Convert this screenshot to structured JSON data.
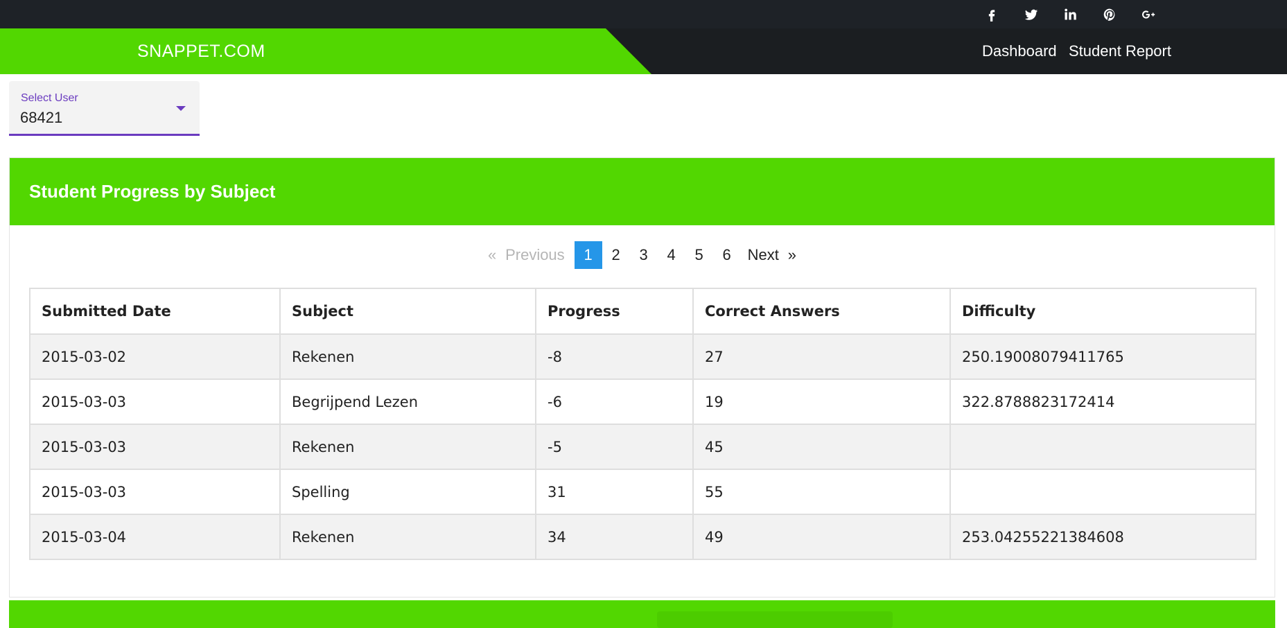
{
  "social": [
    {
      "name": "facebook-icon"
    },
    {
      "name": "twitter-icon"
    },
    {
      "name": "linkedin-icon"
    },
    {
      "name": "pinterest-icon"
    },
    {
      "name": "google-plus-icon"
    }
  ],
  "navbar": {
    "brand": "SNAPPET.COM",
    "links": [
      "Dashboard",
      "Student Report"
    ]
  },
  "select_user": {
    "label": "Select User",
    "value": "68421"
  },
  "card": {
    "title": "Student Progress by Subject",
    "pagination": {
      "prev_arrow": "«",
      "previous": "Previous",
      "pages": [
        "1",
        "2",
        "3",
        "4",
        "5",
        "6"
      ],
      "active": "1",
      "next": "Next",
      "next_arrow": "»"
    },
    "table": {
      "columns": [
        "Submitted Date",
        "Subject",
        "Progress",
        "Correct Answers",
        "Difficulty"
      ],
      "rows": [
        [
          "2015-03-02",
          "Rekenen",
          "-8",
          "27",
          "250.19008079411765"
        ],
        [
          "2015-03-03",
          "Begrijpend Lezen",
          "-6",
          "19",
          "322.8788823172414"
        ],
        [
          "2015-03-03",
          "Rekenen",
          "-5",
          "45",
          ""
        ],
        [
          "2015-03-03",
          "Spelling",
          "31",
          "55",
          ""
        ],
        [
          "2015-03-04",
          "Rekenen",
          "34",
          "49",
          "253.04255221384608"
        ]
      ]
    }
  },
  "colors": {
    "brand_green": "#52d701",
    "dark": "#1b1e21",
    "accent_purple": "#6a3bbf",
    "active_page": "#2596e8"
  }
}
